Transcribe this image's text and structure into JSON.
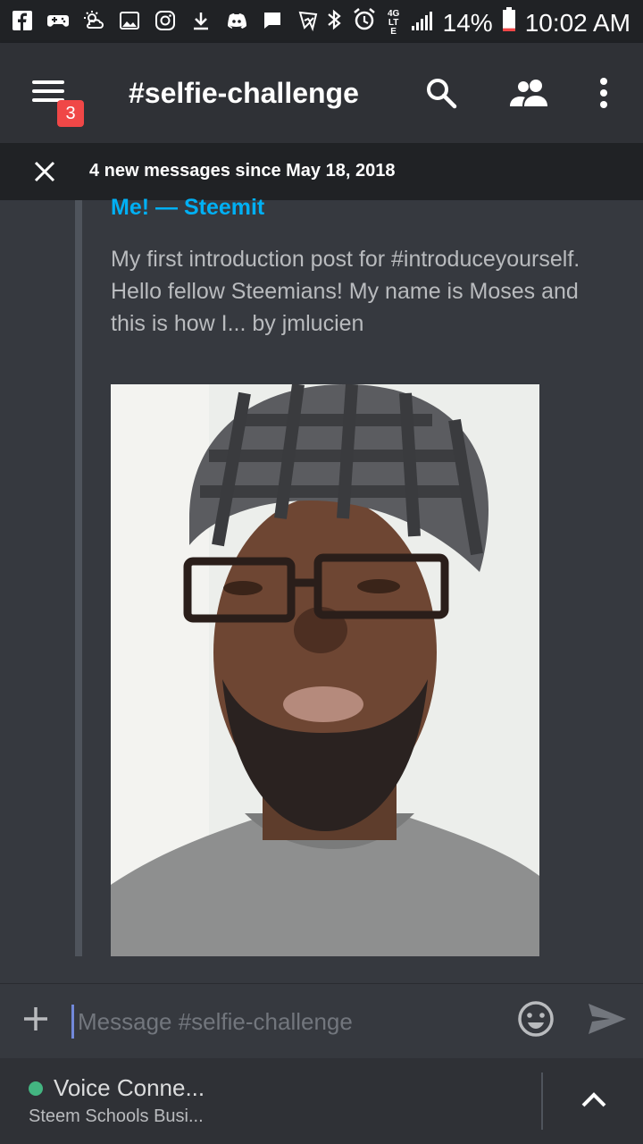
{
  "status_bar": {
    "time": "10:02 AM",
    "battery_percent": "14%",
    "battery_level": 0.14,
    "network_type": "4G LTE",
    "icons": [
      "facebook-icon",
      "gamepad-icon",
      "weather-icon",
      "gallery-icon",
      "instagram-icon",
      "download-icon",
      "discord-icon",
      "chat-icon",
      "messenger-icon",
      "bluetooth-icon",
      "alarm-icon",
      "signal-icon",
      "battery-icon"
    ]
  },
  "header": {
    "channel_name": "#selfie-challenge",
    "unread_badge": "3",
    "menu_icon": "menu-icon",
    "search_icon": "search-icon",
    "members_icon": "members-icon",
    "more_icon": "more-vert-icon"
  },
  "new_messages_bar": {
    "text": "4 new messages since May 18, 2018",
    "close_icon": "close-icon"
  },
  "embed": {
    "title": "Me! — Steemit",
    "description": "My first introduction post for #introduceyourself.  Hello fellow Steemians! My name is Moses and this is how I... by jmlucien"
  },
  "composer": {
    "placeholder": "Message #selfie-challenge",
    "add_icon": "plus-icon",
    "emoji_icon": "emoji-icon",
    "send_icon": "send-icon"
  },
  "voice": {
    "title": "Voice Conne...",
    "subtitle": "Steem Schools Busi...",
    "expand_icon": "chevron-up-icon"
  },
  "colors": {
    "background": "#36393f",
    "header": "#2f3136",
    "status_bar": "#202225",
    "link": "#00b0f4",
    "badge": "#f04747",
    "online": "#43b581"
  }
}
